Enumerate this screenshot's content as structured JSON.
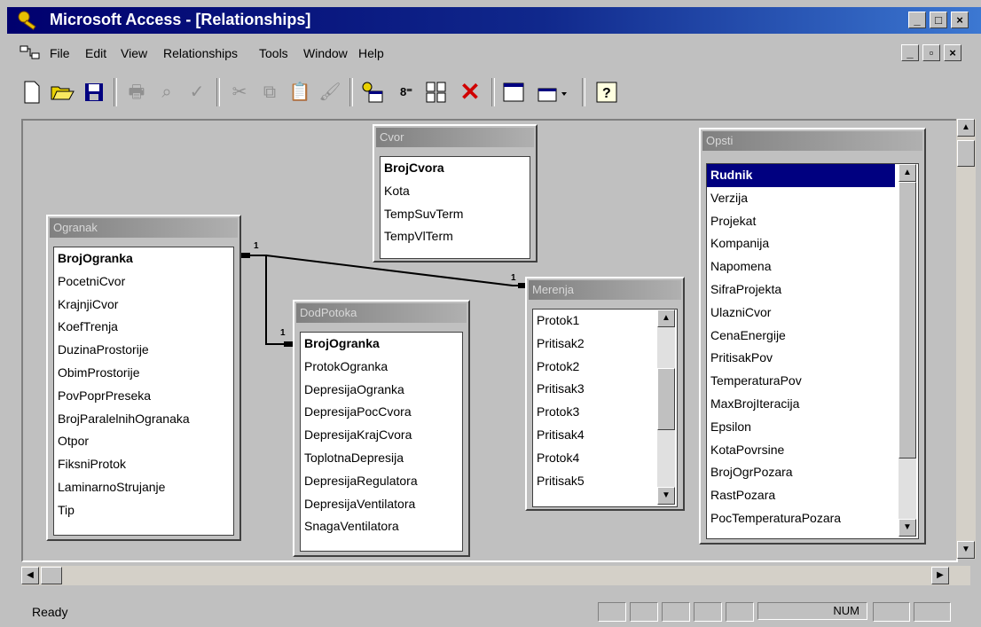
{
  "window": {
    "title": "Microsoft Access - [Relationships]"
  },
  "menu": [
    "File",
    "Edit",
    "View",
    "Relationships",
    "Tools",
    "Window",
    "Help"
  ],
  "tables": {
    "cvor": {
      "caption": "Cvor",
      "fields": [
        "BrojCvora",
        "Kota",
        "TempSuvTerm",
        "TempVlTerm"
      ]
    },
    "ogranak": {
      "caption": "Ogranak",
      "fields": [
        "BrojOgranka",
        "PocetniCvor",
        "KrajnjiCvor",
        "KoefTrenja",
        "DuzinaProstorije",
        "ObimProstorije",
        "PovPoprPreseka",
        "BrojParalelnihOgranaka",
        "Otpor",
        "FiksniProtok",
        "LaminarnoStrujanje",
        "Tip"
      ]
    },
    "dodpotoka": {
      "caption": "DodPotoka",
      "fields": [
        "BrojOgranka",
        "ProtokOgranka",
        "DepresijaOgranka",
        "DepresijaPocCvora",
        "DepresijaKrajCvora",
        "ToplotnaDepresija",
        "DepresijaRegulatora",
        "DepresijaVentilatora",
        "SnagaVentilatora"
      ]
    },
    "merenja": {
      "caption": "Merenja",
      "fields": [
        "Protok1",
        "Pritisak2",
        "Protok2",
        "Pritisak3",
        "Protok3",
        "Pritisak4",
        "Protok4",
        "Pritisak5"
      ]
    },
    "opsti": {
      "caption": "Opsti",
      "fields": [
        "Rudnik",
        "Verzija",
        "Projekat",
        "Kompanija",
        "Napomena",
        "SifraProjekta",
        "UlazniCvor",
        "CenaEnergije",
        "PritisakPov",
        "TemperaturaPov",
        "MaxBrojIteracija",
        "Epsilon",
        "KotaPovrsine",
        "BrojOgrPozara",
        "RastPozara",
        "PocTemperaturaPozara"
      ]
    }
  },
  "relations": {
    "one_label": "1"
  },
  "status": {
    "text": "Ready",
    "num": "NUM"
  }
}
